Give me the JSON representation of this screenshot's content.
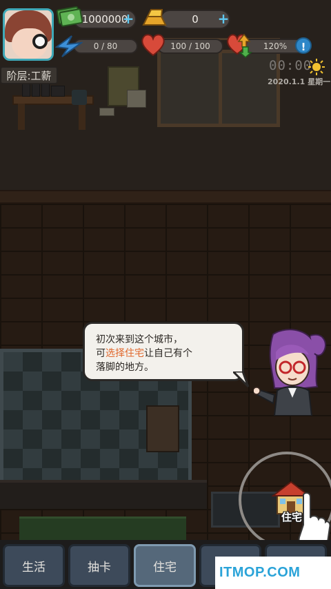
{
  "hud": {
    "money": "1000000",
    "gold": "0",
    "energy": "0 / 80",
    "health": "100 / 100",
    "mood": "120%",
    "rank_label": "阶层:工薪",
    "clock": "00:00",
    "date": "2020.1.1   星期一",
    "info_glyph": "!"
  },
  "dialog": {
    "line1": "初次来到这个城市，",
    "line2_prefix": "可",
    "line2_highlight": "选择住宅",
    "line2_suffix": "让自己有个",
    "line3": "落脚的地方。"
  },
  "house_button": {
    "label": "住宅"
  },
  "tabs": [
    {
      "label": "生活"
    },
    {
      "label": "抽卡"
    },
    {
      "label": "住宅"
    }
  ],
  "watermark": {
    "text": "ITMOP.COM"
  },
  "colors": {
    "highlight": "#e0672c",
    "plus": "#5ec8f0",
    "active_tab": "#55687a",
    "tab": "#3d4a5a"
  }
}
